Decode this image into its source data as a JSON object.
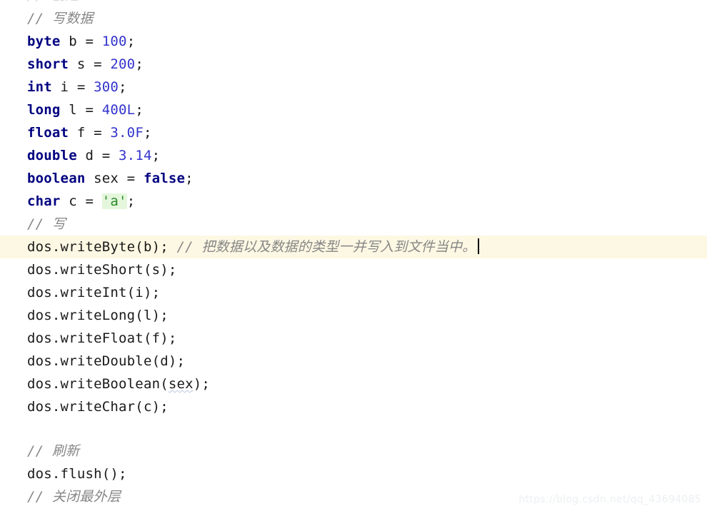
{
  "editor": {
    "language": "java",
    "background_color": "#ffffff",
    "current_line_highlight_color": "#fdf8e3",
    "keyword_color": "#000080",
    "number_color": "#3333cc",
    "comment_color": "#868686",
    "char_literal_color": "#2a8a2a",
    "plain_text_color": "#1a1a1a",
    "caret_color": "#000000"
  },
  "clipped_top_line": {
    "text": "// 创建"
  },
  "lines": [
    {
      "id": "line-comment-write-data",
      "kind": "comment",
      "slashes": "// ",
      "text": "写数据"
    },
    {
      "id": "line-byte",
      "kind": "declaration",
      "keyword": "byte",
      "name": " b = ",
      "value": "100",
      "tail": ";"
    },
    {
      "id": "line-short",
      "kind": "declaration",
      "keyword": "short",
      "name": " s = ",
      "value": "200",
      "tail": ";"
    },
    {
      "id": "line-int",
      "kind": "declaration",
      "keyword": "int",
      "name": " i = ",
      "value": "300",
      "tail": ";"
    },
    {
      "id": "line-long",
      "kind": "declaration",
      "keyword": "long",
      "name": " l = ",
      "value": "400L",
      "tail": ";"
    },
    {
      "id": "line-float",
      "kind": "declaration",
      "keyword": "float",
      "name": " f = ",
      "value": "3.0F",
      "tail": ";"
    },
    {
      "id": "line-double",
      "kind": "declaration",
      "keyword": "double",
      "name": " d = ",
      "value": "3.14",
      "tail": ";"
    },
    {
      "id": "line-boolean",
      "kind": "declaration-bool",
      "keyword": "boolean",
      "name": " sex = ",
      "value": "false",
      "tail": ";"
    },
    {
      "id": "line-char",
      "kind": "declaration-char",
      "keyword": "char",
      "name": " c = ",
      "value": "'a'",
      "tail": ";"
    },
    {
      "id": "line-comment-write",
      "kind": "comment",
      "slashes": "// ",
      "text": "写"
    },
    {
      "id": "line-write-byte",
      "kind": "call-current",
      "code": "dos.writeByte(b); ",
      "slashes": "// ",
      "comment": "把数据以及数据的类型一并写入到文件当中。",
      "has_caret": true
    },
    {
      "id": "line-write-short",
      "kind": "call",
      "code": "dos.writeShort(s);"
    },
    {
      "id": "line-write-int",
      "kind": "call",
      "code": "dos.writeInt(i);"
    },
    {
      "id": "line-write-long",
      "kind": "call",
      "code": "dos.writeLong(l);"
    },
    {
      "id": "line-write-float",
      "kind": "call",
      "code": "dos.writeFloat(f);"
    },
    {
      "id": "line-write-double",
      "kind": "call",
      "code": "dos.writeDouble(d);"
    },
    {
      "id": "line-write-boolean",
      "kind": "call-squiggle",
      "code_before": "dos.writeBoolean(",
      "squiggle_word": "sex",
      "code_after": ");"
    },
    {
      "id": "line-write-char",
      "kind": "call",
      "code": "dos.writeChar(c);"
    },
    {
      "id": "line-blank",
      "kind": "blank",
      "code": ""
    },
    {
      "id": "line-comment-flush",
      "kind": "comment",
      "slashes": "// ",
      "text": "刷新"
    },
    {
      "id": "line-flush",
      "kind": "call",
      "code": "dos.flush();"
    },
    {
      "id": "line-comment-close",
      "kind": "comment",
      "slashes": "// ",
      "text": "关闭最外层"
    }
  ],
  "watermark": {
    "text": "https://blog.csdn.net/qq_43694085"
  }
}
